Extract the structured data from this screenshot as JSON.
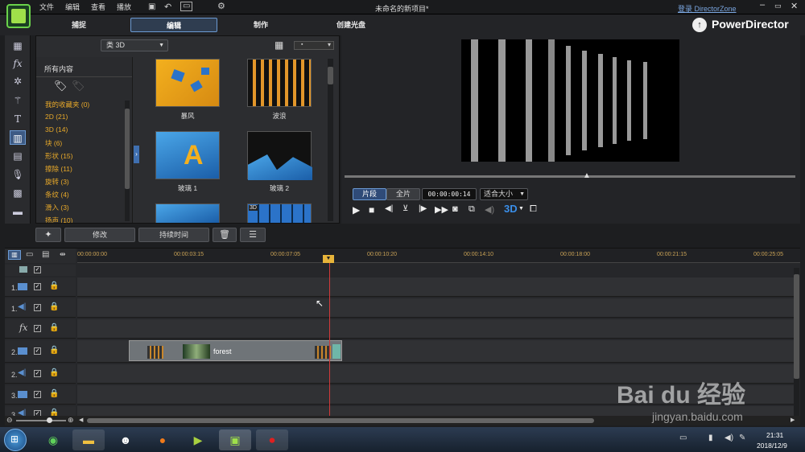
{
  "menubar": {
    "items": [
      "文件",
      "编辑",
      "查看",
      "播放"
    ],
    "project_title": "未命名的新项目*",
    "login_link": "登录 DirectorZone"
  },
  "modes": {
    "capture": "捕捉",
    "edit": "编辑",
    "produce": "制作",
    "disc": "创建光盘"
  },
  "app_name": "PowerDirector",
  "library": {
    "type_dropdown": "类 3D",
    "all_content": "所有内容",
    "categories": [
      "我的收藏夹 (0)",
      "2D (21)",
      "3D (14)",
      "块 (6)",
      "形状 (15)",
      "擦除 (11)",
      "旋转 (3)",
      "条纹 (4)",
      "滑入 (3)",
      "扬声 (10)"
    ],
    "thumbnails": [
      "暴风",
      "波浪",
      "玻璃 1",
      "玻璃 2"
    ],
    "partial_badge": "3D"
  },
  "preview": {
    "clip_tab": "片段",
    "movie_tab": "全片",
    "timecode": "00:00:00:14",
    "fit_select": "适合大小",
    "stereo_3d": "3D"
  },
  "edit_bar": {
    "modify": "修改",
    "duration": "持续时间"
  },
  "timeline": {
    "ruler": [
      "00:00:00:00",
      "00:00:03:15",
      "00:00:07:05",
      "00:00:10:20",
      "00:00:14:10",
      "00:00:18:00",
      "00:00:21:15",
      "00:00:25:05"
    ],
    "tracks": [
      {
        "num": "1.",
        "type": "video"
      },
      {
        "num": "1.",
        "type": "audio"
      },
      {
        "num": "",
        "type": "fx"
      },
      {
        "num": "2.",
        "type": "video"
      },
      {
        "num": "2.",
        "type": "audio"
      },
      {
        "num": "3.",
        "type": "video"
      },
      {
        "num": "3.",
        "type": "audio"
      }
    ],
    "clip_name": "forest"
  },
  "taskbar": {
    "time": "21:31",
    "date": "2018/12/9"
  },
  "watermark": {
    "brand": "Bai du 经验",
    "url": "jingyan.baidu.com"
  },
  "colors": {
    "accent": "#6b9ad3",
    "category": "#e8a92a",
    "playhead": "#d23a3a"
  }
}
